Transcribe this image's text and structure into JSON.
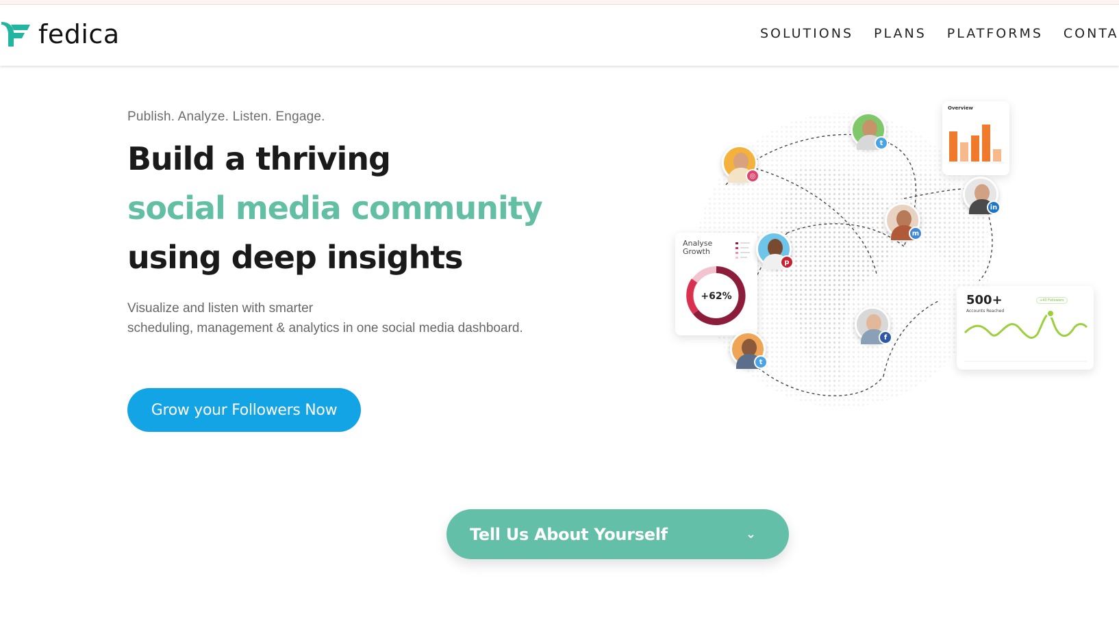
{
  "brand": {
    "name": "fedica",
    "color": "#22b5a0"
  },
  "nav": {
    "items": [
      "SOLUTIONS",
      "PLANS",
      "PLATFORMS",
      "CONTACT"
    ]
  },
  "hero": {
    "tagline": "Publish. Analyze. Listen. Engage.",
    "headline_line1": "Build a thriving",
    "headline_line2": "social media community",
    "headline_line3": "using deep insights",
    "subtitle_line1": "Visualize and listen with smarter",
    "subtitle_line2": "scheduling, management & analytics in one social media dashboard.",
    "cta_label": "Grow your Followers Now",
    "accent_color": "#63bfa3",
    "cta_color": "#13a4e6"
  },
  "illustration": {
    "overview_title": "Overview",
    "growth_title": "Analyse Growth",
    "growth_value": "+62%",
    "reach_value": "500+",
    "reach_label": "Accounts Reached",
    "reach_pill": "+43 Followers",
    "avatars": [
      {
        "name": "twitter-user-1",
        "badge": "twitter"
      },
      {
        "name": "instagram-user",
        "badge": "instagram"
      },
      {
        "name": "linkedin-user",
        "badge": "linkedin"
      },
      {
        "name": "mastodon-user",
        "badge": "mastodon"
      },
      {
        "name": "pinterest-user",
        "badge": "pinterest"
      },
      {
        "name": "facebook-user",
        "badge": "facebook"
      },
      {
        "name": "twitter-user-2",
        "badge": "twitter"
      }
    ]
  },
  "dropdown": {
    "label": "Tell Us About Yourself",
    "color": "#63bfa8",
    "icon": "chevron-down-icon"
  }
}
